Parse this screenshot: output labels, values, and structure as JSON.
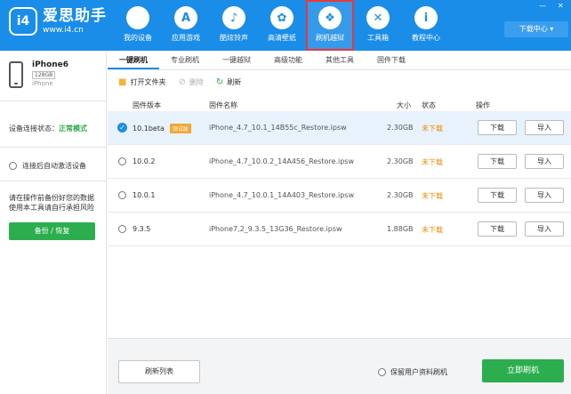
{
  "app": {
    "name": "爱思助手",
    "url": "www.i4.cn"
  },
  "nav": [
    {
      "label": "我的设备",
      "icon": "apple-icon",
      "glyph": ""
    },
    {
      "label": "应用游戏",
      "icon": "app-store-icon",
      "glyph": "A"
    },
    {
      "label": "酷炫铃声",
      "icon": "bell-icon",
      "glyph": "♪"
    },
    {
      "label": "高清壁纸",
      "icon": "flower-icon",
      "glyph": "✿"
    },
    {
      "label": "刷机越狱",
      "icon": "dropbox-icon",
      "glyph": "❖"
    },
    {
      "label": "工具箱",
      "icon": "tools-icon",
      "glyph": "✕"
    },
    {
      "label": "教程中心",
      "icon": "info-icon",
      "glyph": "i"
    }
  ],
  "active_nav": 4,
  "window": {
    "download_center": "下载中心 ▾",
    "minimize": "—",
    "close": "✕"
  },
  "device": {
    "name": "iPhone6",
    "capacity": "128GB",
    "model": "iPhone"
  },
  "sidebar": {
    "connection_label": "设备连接状态：",
    "connection_value": "正常模式",
    "auto_activate": "连接后自动激活设备",
    "warning": "请在操作前备份好您的数据 使用本工具请自行承担风险",
    "backup_button": "备份 / 恢复"
  },
  "tabs": [
    "一键刷机",
    "专业刷机",
    "一键越狱",
    "高级功能",
    "其他工具",
    "固件下载"
  ],
  "active_tab": 0,
  "toolbar": {
    "open_folder": "打开文件夹",
    "delete": "删除",
    "refresh": "刷新"
  },
  "table": {
    "headers": {
      "version": "固件版本",
      "name": "固件名称",
      "size": "大小",
      "status": "状态",
      "action": "操作"
    },
    "rows": [
      {
        "version": "10.1beta",
        "badge": "测试版",
        "name": "iPhone_4.7_10.1_14B55c_Restore.ipsw",
        "size": "2.30GB",
        "status": "未下载",
        "download": "下载",
        "import": "导入",
        "selected": true
      },
      {
        "version": "10.0.2",
        "badge": "",
        "name": "iPhone_4.7_10.0.2_14A456_Restore.ipsw",
        "size": "2.30GB",
        "status": "未下载",
        "download": "下载",
        "import": "导入",
        "selected": false
      },
      {
        "version": "10.0.1",
        "badge": "",
        "name": "iPhone_4.7_10.0.1_14A403_Restore.ipsw",
        "size": "2.30GB",
        "status": "未下载",
        "download": "下载",
        "import": "导入",
        "selected": false
      },
      {
        "version": "9.3.5",
        "badge": "",
        "name": "iPhone7,2_9.3.5_13G36_Restore.ipsw",
        "size": "1.88GB",
        "status": "未下载",
        "download": "下载",
        "import": "导入",
        "selected": false
      }
    ]
  },
  "bottom": {
    "refresh_list": "刷新列表",
    "keep_data": "保留用户资料刷机",
    "flash_now": "立即刷机"
  }
}
